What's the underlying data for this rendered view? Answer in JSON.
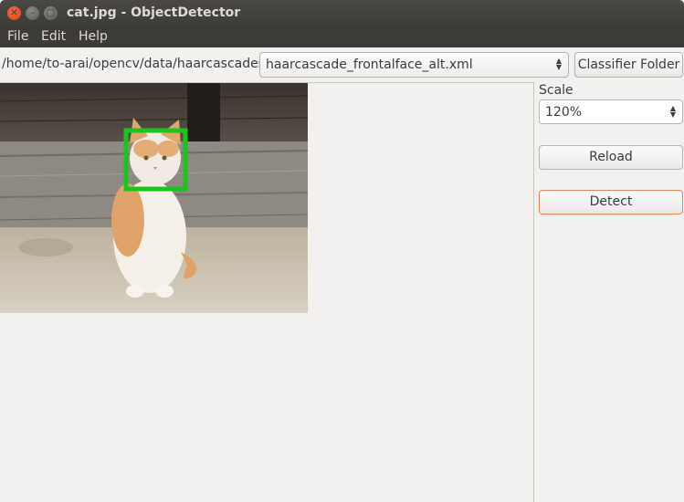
{
  "window": {
    "title": "cat.jpg - ObjectDetector"
  },
  "menu": {
    "file": "File",
    "edit": "Edit",
    "help": "Help"
  },
  "toolbar": {
    "path": "/home/to-arai/opencv/data/haarcascades",
    "classifier": "haarcascade_frontalface_alt.xml",
    "classifier_folder_label": "Classifier Folder"
  },
  "side": {
    "scale_label": "Scale",
    "scale_value": "120%",
    "reload_label": "Reload",
    "detect_label": "Detect"
  },
  "colors": {
    "detection_box": "#1ec41e",
    "detect_focus": "#e9845f"
  }
}
